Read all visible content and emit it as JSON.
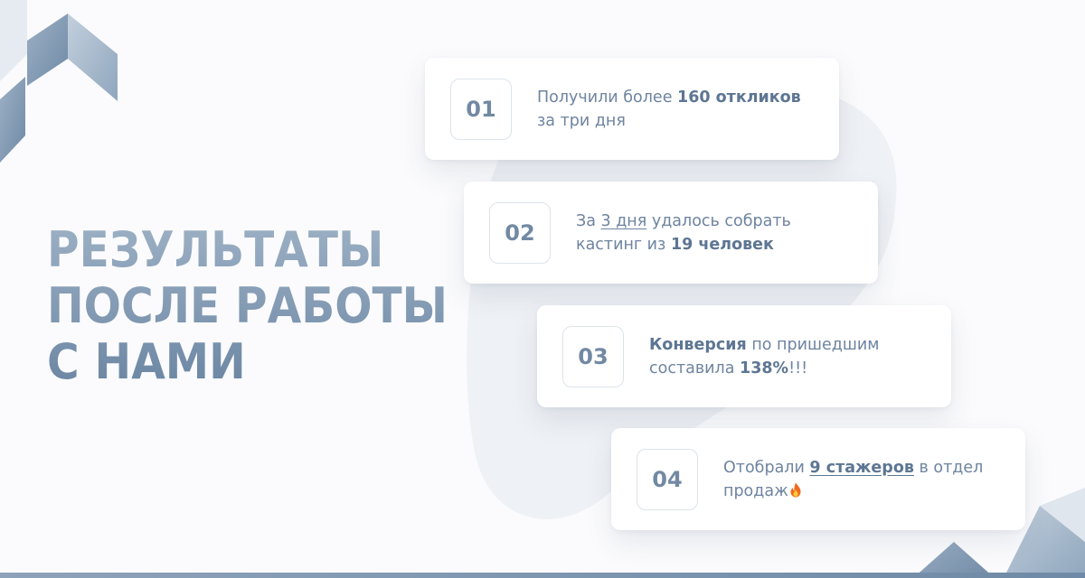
{
  "title": {
    "lines": [
      "РЕЗУЛЬТАТЫ",
      "ПОСЛЕ РАБОТЫ",
      "С НАМИ"
    ]
  },
  "cards": [
    {
      "number": "01",
      "line1": {
        "a": "Получили более ",
        "b": "160 откликов"
      },
      "line2": "за три дня"
    },
    {
      "number": "02",
      "line1": {
        "a": "За ",
        "b": "3 дня",
        "c": " удалось собрать"
      },
      "line2": {
        "a": "кастинг из ",
        "b": "19 человек"
      }
    },
    {
      "number": "03",
      "line1": {
        "a": "Конверсия",
        "b": " по пришедшим"
      },
      "line2": {
        "a": "составила ",
        "b": "138%",
        "c": "!!!"
      }
    },
    {
      "number": "04",
      "line1": {
        "a": "Отобрали ",
        "b": "9 стажеров",
        "c": " в отдел"
      },
      "line2": {
        "a": "продаж",
        "icon": "fire-icon"
      }
    }
  ],
  "colors": {
    "accent": "#6e84a0",
    "title": "#7a93ad",
    "card_bg": "#ffffff",
    "page_bg": "#fbfbfd"
  }
}
